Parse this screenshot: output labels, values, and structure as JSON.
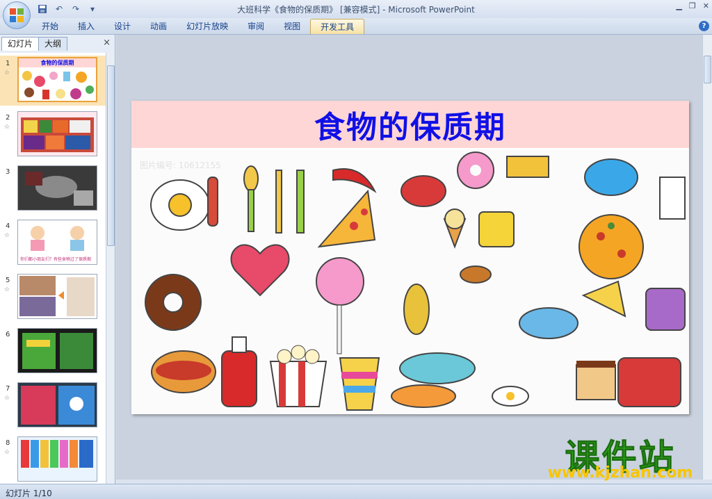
{
  "window": {
    "title": "大班科学《食物的保质期》 [兼容模式] - Microsoft PowerPoint"
  },
  "ribbon": {
    "tabs": [
      {
        "label": "开始"
      },
      {
        "label": "插入"
      },
      {
        "label": "设计"
      },
      {
        "label": "动画"
      },
      {
        "label": "幻灯片放映"
      },
      {
        "label": "审阅"
      },
      {
        "label": "视图"
      },
      {
        "label": "开发工具",
        "active": true
      }
    ],
    "help": "?"
  },
  "panel": {
    "tab_slides": "幻灯片",
    "tab_outline": "大纲",
    "close": "×"
  },
  "thumbnails": [
    {
      "num": "1",
      "star": "☆",
      "selected": true,
      "mini_title": "食物的保质期"
    },
    {
      "num": "2",
      "star": "☆"
    },
    {
      "num": "3",
      "star": ""
    },
    {
      "num": "4",
      "star": "☆",
      "mini_caption": "你们都小朋友们？有些食物过了保质期"
    },
    {
      "num": "5",
      "star": "☆"
    },
    {
      "num": "6",
      "star": ""
    },
    {
      "num": "7",
      "star": "☆"
    },
    {
      "num": "8",
      "star": "☆"
    }
  ],
  "slide": {
    "title": "食物的保质期",
    "watermark": "图片编号: 10612155"
  },
  "brand": {
    "name": "课件站",
    "url": "www.kjzhan.com"
  },
  "status": {
    "slide_counter": "幻灯片 1/10"
  },
  "colors": {
    "title_blue": "#1010e6",
    "header_pink": "#ffd6d6",
    "selection_orange": "#e9a23b",
    "brand_green": "#2ea81a",
    "brand_yellow": "#f7c500"
  }
}
